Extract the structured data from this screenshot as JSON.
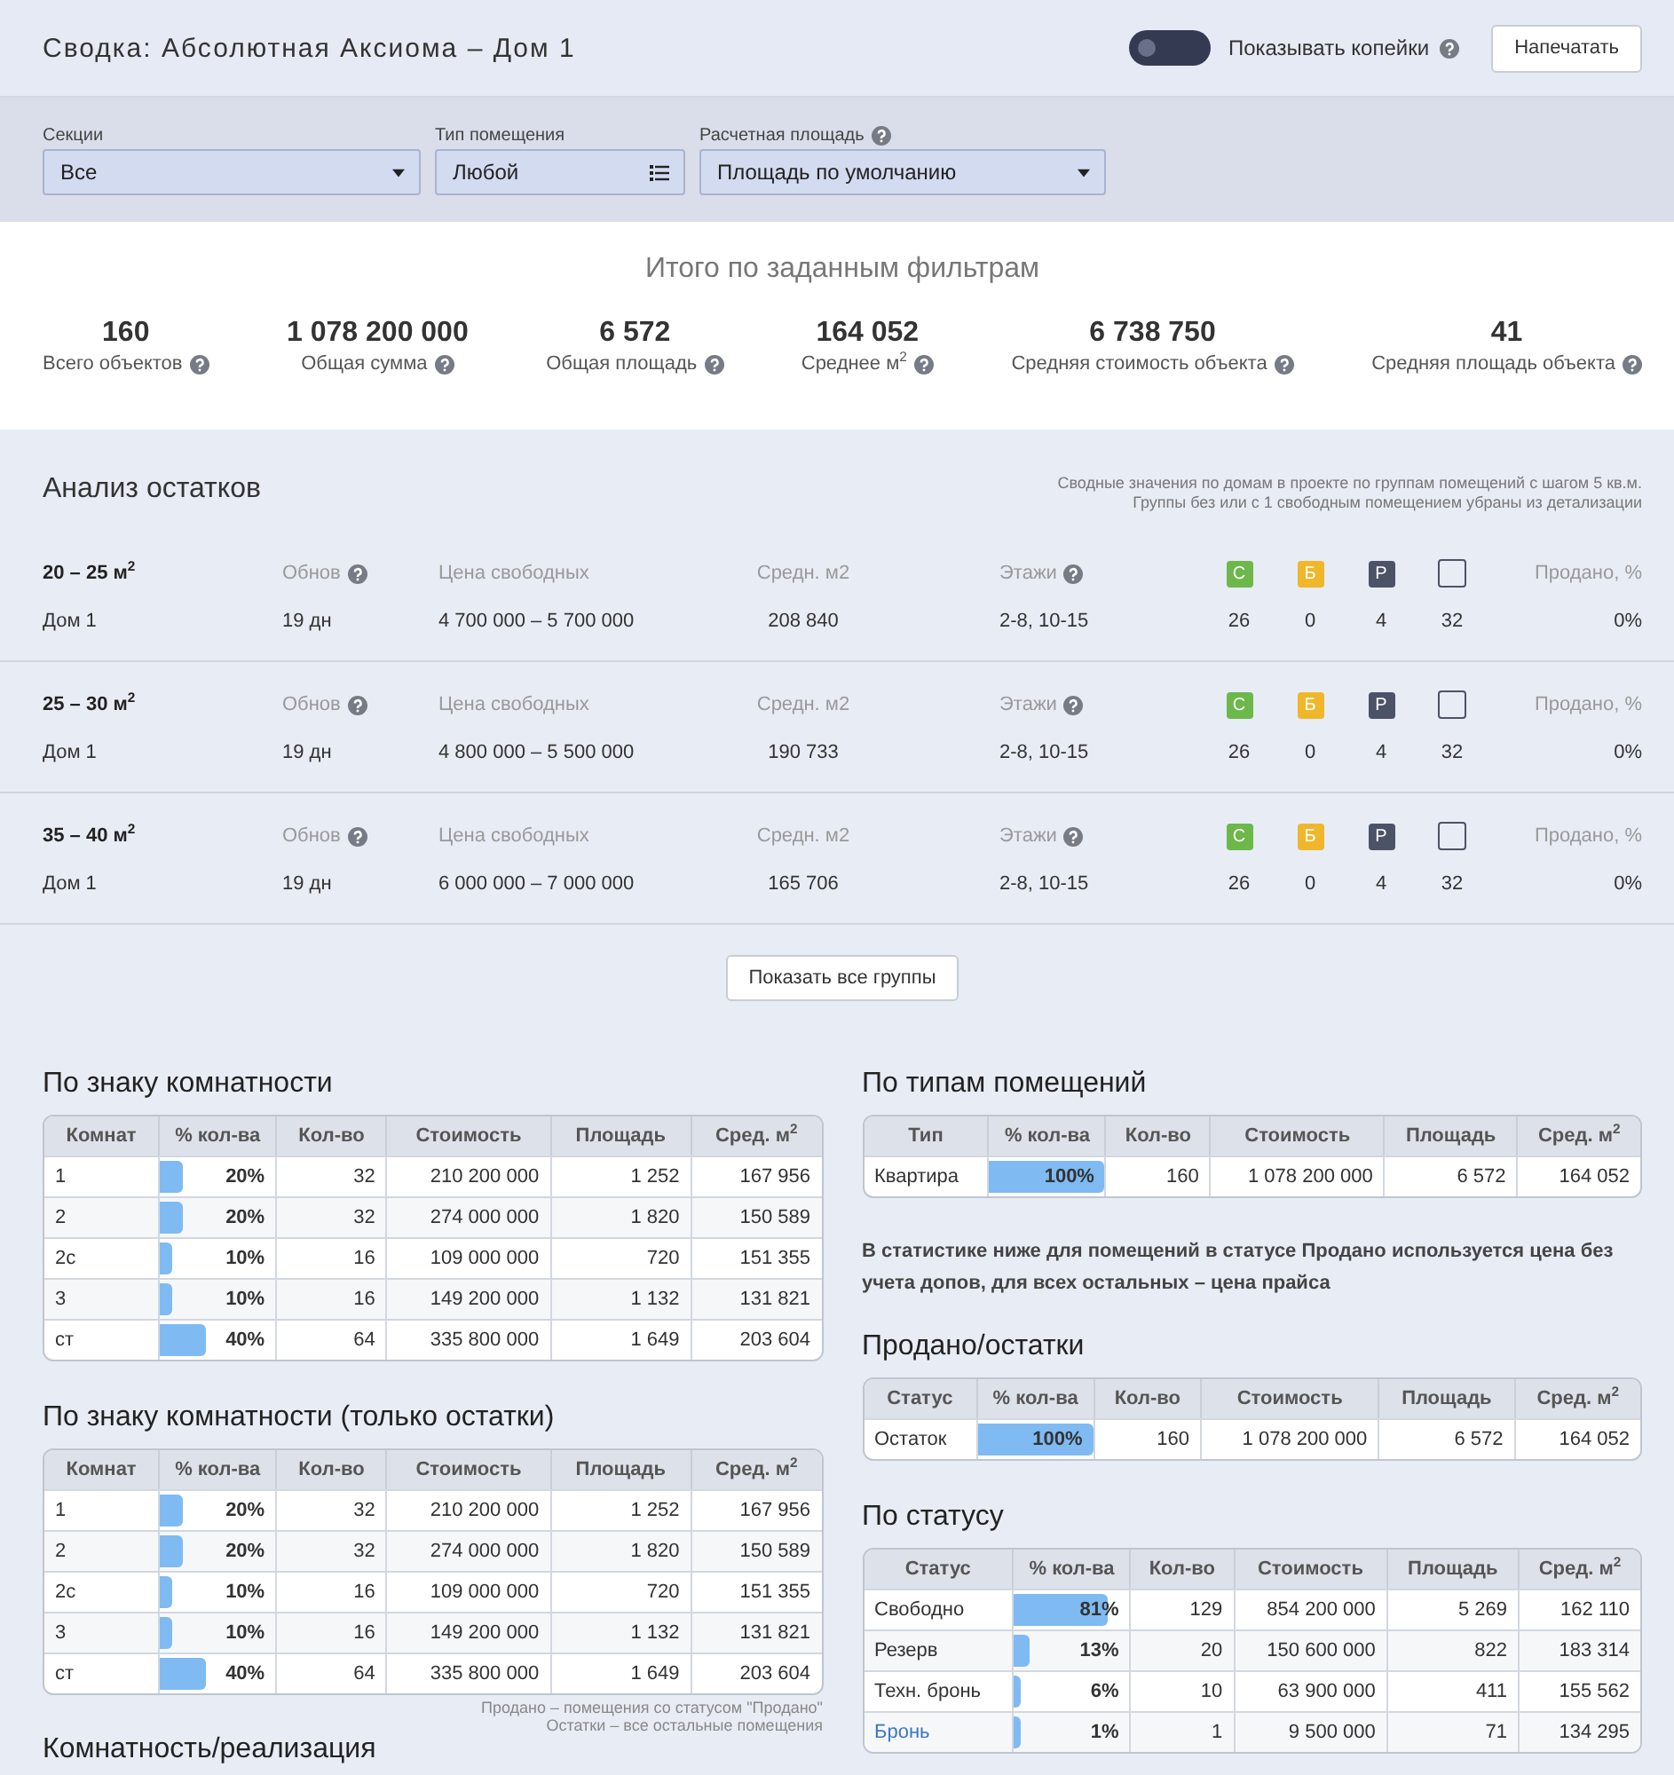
{
  "header": {
    "title": "Сводка: Абсолютная Аксиома – Дом 1",
    "kopecks_toggle": {
      "label": "Показывать копейки",
      "on": false
    },
    "print_button": "Напечатать"
  },
  "filters": [
    {
      "label": "Секции",
      "help": false,
      "value": "Все",
      "kind": "select"
    },
    {
      "label": "Тип помещения",
      "help": false,
      "value": "Любой",
      "kind": "multiselect"
    },
    {
      "label": "Расчетная площадь",
      "help": true,
      "value": "Площадь по умолчанию",
      "kind": "select"
    }
  ],
  "totals": {
    "title": "Итого по заданным фильтрам",
    "items": [
      {
        "value": "160",
        "label": "Всего объектов"
      },
      {
        "value": "1 078 200 000",
        "label": "Общая сумма"
      },
      {
        "value": "6 572",
        "label": "Общая площадь"
      },
      {
        "value": "164 052",
        "label": "Среднее м$^{2}$"
      },
      {
        "value": "6 738 750",
        "label": "Средняя стоимость объекта"
      },
      {
        "value": "41",
        "label": "Средняя площадь объекта"
      }
    ]
  },
  "analysis": {
    "title": "Анализ остатков",
    "note": [
      "Сводные значения по домам в проекте по группам помещений с шагом 5 кв.м.",
      "Группы без или с 1 свободным помещением убраны из детализации"
    ],
    "groups": [
      {
        "title": "20 – 25 м$^{2}$",
        "house": "Дом 1",
        "columns": [
          {
            "label": "Обнов",
            "help": true,
            "value": "19 дн"
          },
          {
            "label": "Цена свободных",
            "help": false,
            "value": "4 700 000 – 5 700 000"
          },
          {
            "label": "Средн. м2",
            "help": false,
            "value": "208 840"
          },
          {
            "label": "Этажи",
            "help": true,
            "value": "2-8, 10-15"
          }
        ],
        "badges": [
          {
            "kind": "filled",
            "label": "С",
            "color": "#6cb84a",
            "value": "26"
          },
          {
            "kind": "filled",
            "label": "Б",
            "color": "#f0b72b",
            "value": "0"
          },
          {
            "kind": "filled",
            "label": "Р",
            "color": "#4d5366",
            "value": "4"
          },
          {
            "kind": "outline",
            "color": "#4d5366",
            "value": "32"
          }
        ],
        "sold": {
          "label": "Продано, %",
          "value": "0%"
        }
      },
      {
        "title": "25 – 30 м$^{2}$",
        "house": "Дом 1",
        "columns": [
          {
            "label": "Обнов",
            "help": true,
            "value": "19 дн"
          },
          {
            "label": "Цена свободных",
            "help": false,
            "value": "4 800 000 – 5 500 000"
          },
          {
            "label": "Средн. м2",
            "help": false,
            "value": "190 733"
          },
          {
            "label": "Этажи",
            "help": true,
            "value": "2-8, 10-15"
          }
        ],
        "badges": [
          {
            "kind": "filled",
            "label": "С",
            "color": "#6cb84a",
            "value": "26"
          },
          {
            "kind": "filled",
            "label": "Б",
            "color": "#f0b72b",
            "value": "0"
          },
          {
            "kind": "filled",
            "label": "Р",
            "color": "#4d5366",
            "value": "4"
          },
          {
            "kind": "outline",
            "color": "#4d5366",
            "value": "32"
          }
        ],
        "sold": {
          "label": "Продано, %",
          "value": "0%"
        }
      },
      {
        "title": "35 – 40 м$^{2}$",
        "house": "Дом 1",
        "columns": [
          {
            "label": "Обнов",
            "help": true,
            "value": "19 дн"
          },
          {
            "label": "Цена свободных",
            "help": false,
            "value": "6 000 000 – 7 000 000"
          },
          {
            "label": "Средн. м2",
            "help": false,
            "value": "165 706"
          },
          {
            "label": "Этажи",
            "help": true,
            "value": "2-8, 10-15"
          }
        ],
        "badges": [
          {
            "kind": "filled",
            "label": "С",
            "color": "#6cb84a",
            "value": "26"
          },
          {
            "kind": "filled",
            "label": "Б",
            "color": "#f0b72b",
            "value": "0"
          },
          {
            "kind": "filled",
            "label": "Р",
            "color": "#4d5366",
            "value": "4"
          },
          {
            "kind": "outline",
            "color": "#4d5366",
            "value": "32"
          }
        ],
        "sold": {
          "label": "Продано, %",
          "value": "0%"
        }
      }
    ],
    "show_all_button": "Показать все группы"
  },
  "left_column": [
    {
      "kind": "table",
      "title": "По знаку комнатности",
      "columns": [
        "Комнат",
        "% кол-ва",
        "Кол-во",
        "Стоимость",
        "Площадь",
        "Сред. м$^{2}$"
      ],
      "rows": [
        {
          "cells": [
            "1",
            "20%",
            "32",
            "210 200 000",
            "1 252",
            "167 956"
          ],
          "level": 0.2,
          "link": false
        },
        {
          "cells": [
            "2",
            "20%",
            "32",
            "274 000 000",
            "1 820",
            "150 589"
          ],
          "level": 0.2,
          "link": false
        },
        {
          "cells": [
            "2с",
            "10%",
            "16",
            "109 000 000",
            "720",
            "151 355"
          ],
          "level": 0.1,
          "link": false
        },
        {
          "cells": [
            "3",
            "10%",
            "16",
            "149 200 000",
            "1 132",
            "131 821"
          ],
          "level": 0.1,
          "link": false
        },
        {
          "cells": [
            "ст",
            "40%",
            "64",
            "335 800 000",
            "1 649",
            "203 604"
          ],
          "level": 0.4,
          "link": false
        }
      ]
    },
    {
      "kind": "table",
      "title": "По знаку комнатности (только остатки)",
      "columns": [
        "Комнат",
        "% кол-ва",
        "Кол-во",
        "Стоимость",
        "Площадь",
        "Сред. м$^{2}$"
      ],
      "rows": [
        {
          "cells": [
            "1",
            "20%",
            "32",
            "210 200 000",
            "1 252",
            "167 956"
          ],
          "level": 0.2,
          "link": false
        },
        {
          "cells": [
            "2",
            "20%",
            "32",
            "274 000 000",
            "1 820",
            "150 589"
          ],
          "level": 0.2,
          "link": false
        },
        {
          "cells": [
            "2с",
            "10%",
            "16",
            "109 000 000",
            "720",
            "151 355"
          ],
          "level": 0.1,
          "link": false
        },
        {
          "cells": [
            "3",
            "10%",
            "16",
            "149 200 000",
            "1 132",
            "131 821"
          ],
          "level": 0.1,
          "link": false
        },
        {
          "cells": [
            "ст",
            "40%",
            "64",
            "335 800 000",
            "1 649",
            "203 604"
          ],
          "level": 0.4,
          "link": false
        }
      ]
    },
    {
      "kind": "footnote",
      "lines": [
        "Продано – помещения со статусом \"Продано\"",
        "Остатки – все остальные помещения"
      ]
    },
    {
      "kind": "heading",
      "title": "Комнатность/реализация"
    }
  ],
  "right_column": [
    {
      "kind": "table",
      "title": "По типам помещений",
      "columns": [
        "Тип",
        "% кол-ва",
        "Кол-во",
        "Стоимость",
        "Площадь",
        "Сред. м$^{2}$"
      ],
      "rows": [
        {
          "cells": [
            "Квартира",
            "100%",
            "160",
            "1 078 200 000",
            "6 572",
            "164 052"
          ],
          "level": 1,
          "link": false
        }
      ]
    },
    {
      "kind": "note",
      "text": "В статистике ниже для помещений в статусе Продано используется цена без учета допов, для всех остальных – цена прайса"
    },
    {
      "kind": "table",
      "title": "Продано/остатки",
      "columns": [
        "Статус",
        "% кол-ва",
        "Кол-во",
        "Стоимость",
        "Площадь",
        "Сред. м$^{2}$"
      ],
      "rows": [
        {
          "cells": [
            "Остаток",
            "100%",
            "160",
            "1 078 200 000",
            "6 572",
            "164 052"
          ],
          "level": 1,
          "link": false
        }
      ]
    },
    {
      "kind": "table",
      "title": "По статусу",
      "columns": [
        "Статус",
        "% кол-ва",
        "Кол-во",
        "Стоимость",
        "Площадь",
        "Сред. м$^{2}$"
      ],
      "rows": [
        {
          "cells": [
            "Свободно",
            "81%",
            "129",
            "854 200 000",
            "5 269",
            "162 110"
          ],
          "level": 0.81,
          "link": false
        },
        {
          "cells": [
            "Резерв",
            "13%",
            "20",
            "150 600 000",
            "822",
            "183 314"
          ],
          "level": 0.13,
          "link": false
        },
        {
          "cells": [
            "Техн. бронь",
            "6%",
            "10",
            "63 900 000",
            "411",
            "155 562"
          ],
          "level": 0.06,
          "link": false
        },
        {
          "cells": [
            "Бронь",
            "1%",
            "1",
            "9 500 000",
            "71",
            "134 295"
          ],
          "level": 0.01,
          "link": true
        }
      ]
    }
  ]
}
